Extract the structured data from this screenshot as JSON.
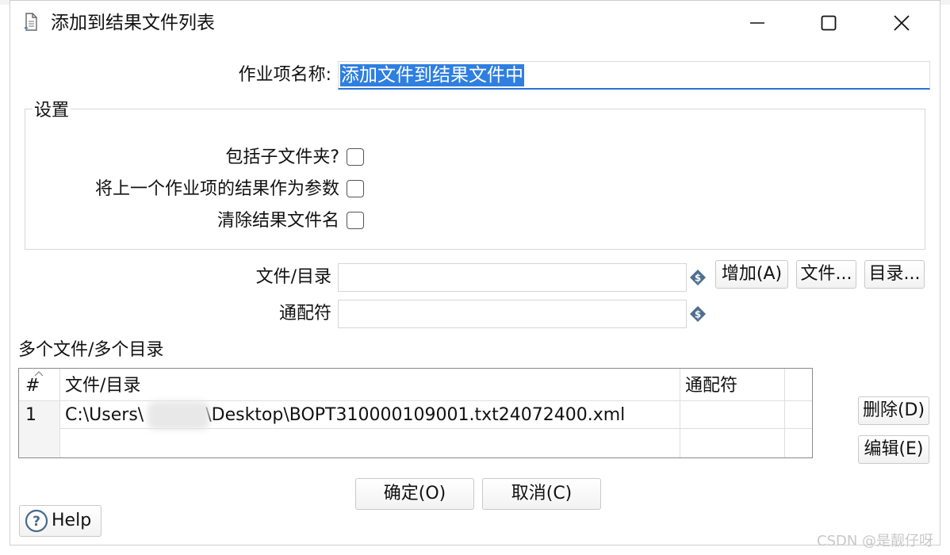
{
  "window": {
    "title": "添加到结果文件列表"
  },
  "form": {
    "job_name_label": "作业项名称:",
    "job_name_value": "添加文件到结果文件中"
  },
  "settings": {
    "group_title": "设置",
    "include_subfolders_label": "包括子文件夹?",
    "include_subfolders_checked": false,
    "prev_result_as_args_label": "将上一个作业项的结果作为参数",
    "prev_result_as_args_checked": false,
    "clear_result_filenames_label": "清除结果文件名",
    "clear_result_filenames_checked": false
  },
  "file_entry": {
    "file_dir_label": "文件/目录",
    "file_dir_value": "",
    "wildcard_label": "通配符",
    "wildcard_value": "",
    "add_button": "增加(A)",
    "file_button": "文件...",
    "dir_button": "目录..."
  },
  "file_list": {
    "section_label": "多个文件/多个目录",
    "columns": [
      "#",
      "文件/目录",
      "通配符"
    ],
    "rows": [
      {
        "index": "1",
        "path": "C:\\Users\\",
        "path_suffix": "\\Desktop\\BOPT310000109001.txt24072400.xml",
        "wildcard": ""
      }
    ],
    "delete_button": "删除(D)",
    "edit_button": "编辑(E)"
  },
  "footer": {
    "ok_button": "确定(O)",
    "cancel_button": "取消(C)",
    "help_button": "Help"
  },
  "watermark": "CSDN @是靓仔呀",
  "colors": {
    "accent": "#2f7fe0",
    "variable_icon": "#4f6f8f"
  },
  "icons": {
    "title": "document-icon",
    "variable": "dollar-variable-icon",
    "help": "question-circle-icon"
  }
}
